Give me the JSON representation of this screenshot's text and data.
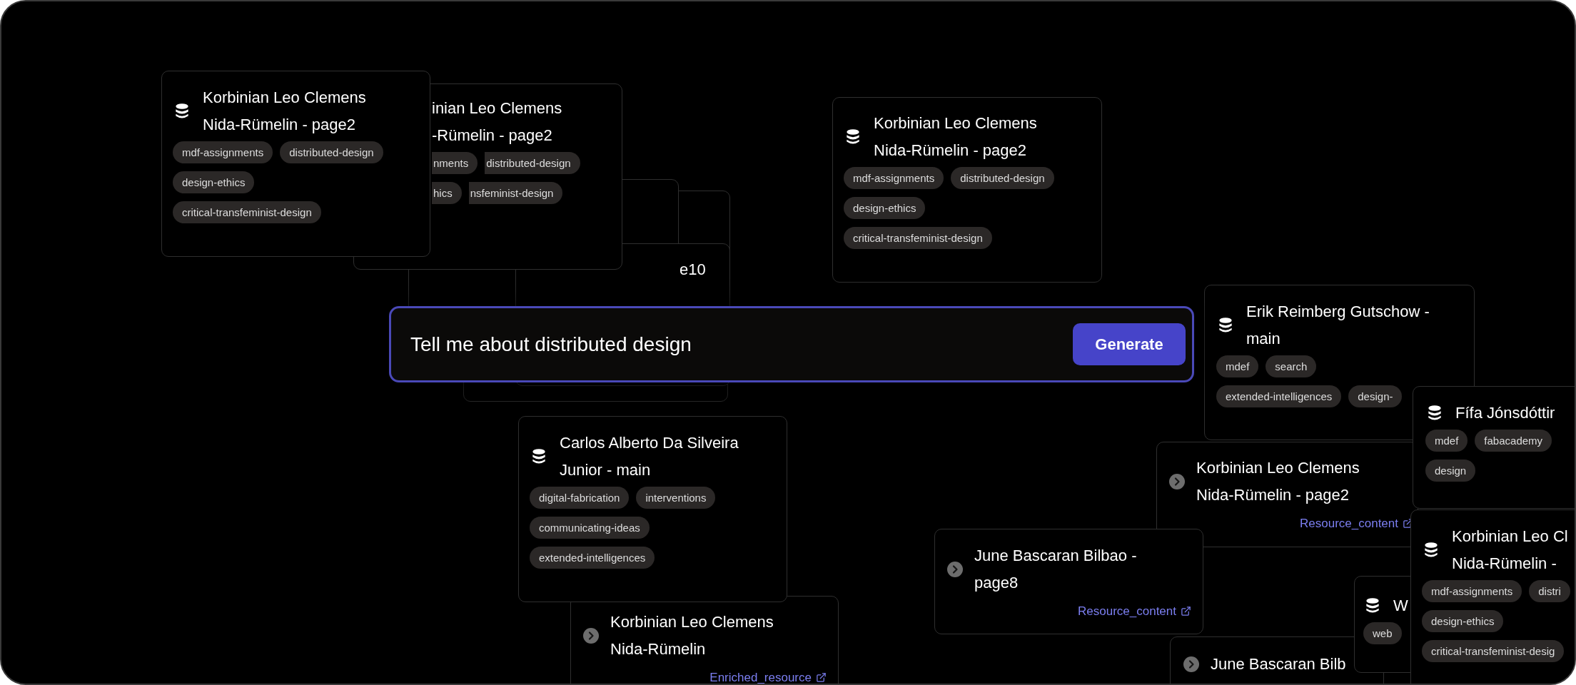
{
  "prompt": {
    "value": "Tell me about distributed design"
  },
  "generate_button": "Generate",
  "cards": [
    {
      "kind": "dataset",
      "title_lines": [
        "Korbinian Leo Clemens",
        "Nida-Rümelin - page2"
      ],
      "tags": [
        "mdf-assignments",
        "distributed-design",
        "design-ethics",
        "critical-transfeminist-design"
      ]
    },
    {
      "title_lines": [
        "inian Leo Clemens",
        "-Rümelin - page2"
      ],
      "tags": [
        "nments",
        "distributed-design",
        "hics",
        "nsfeminist-design"
      ]
    },
    {
      "kind": "dataset",
      "title_lines": [
        "Korbinian Leo Clemens",
        "Nida-Rümelin - page2"
      ],
      "tags": [
        "mdf-assignments",
        "distributed-design",
        "design-ethics",
        "critical-transfeminist-design"
      ]
    },
    {
      "title_lines": [
        "e10"
      ]
    },
    {
      "kind": "dataset",
      "title_lines": [
        "Erik Reimberg Gutschow -",
        "main"
      ],
      "tags": [
        "mdef",
        "search",
        "extended-intelligences",
        "design-"
      ]
    },
    {
      "kind": "dataset",
      "title_lines": [
        "Fífa Jónsdóttir"
      ],
      "tags": [
        "mdef",
        "fabacademy",
        "design"
      ]
    },
    {
      "kind": "dataset",
      "title_lines": [
        "Carlos Alberto Da Silveira",
        "Junior - main"
      ],
      "tags": [
        "digital-fabrication",
        "interventions",
        "communicating-ideas",
        "extended-intelligences"
      ]
    },
    {
      "kind": "resource",
      "title_lines": [
        "Korbinian Leo Clemens",
        "Nida-Rümelin - page2"
      ],
      "link": "Resource_content"
    },
    {
      "kind": "dataset",
      "title_lines": [
        "Korbinian Leo Cl",
        "Nida-Rümelin -"
      ],
      "tags": [
        "mdf-assignments",
        "distri",
        "design-ethics",
        "critical-transfeminist-desig"
      ]
    },
    {
      "kind": "resource",
      "title_lines": [
        "June Bascaran Bilbao -",
        "page8"
      ],
      "link": "Resource_content"
    },
    {
      "kind": "dataset",
      "title_lines": [
        "W"
      ],
      "tags": [
        "web"
      ]
    },
    {
      "kind": "resource",
      "title_lines": [
        "June Bascaran Bilb"
      ]
    },
    {
      "kind": "resource",
      "title_lines": [
        "Korbinian Leo Clemens",
        "Nida-Rümelin"
      ],
      "link": "Enriched_resource"
    }
  ]
}
